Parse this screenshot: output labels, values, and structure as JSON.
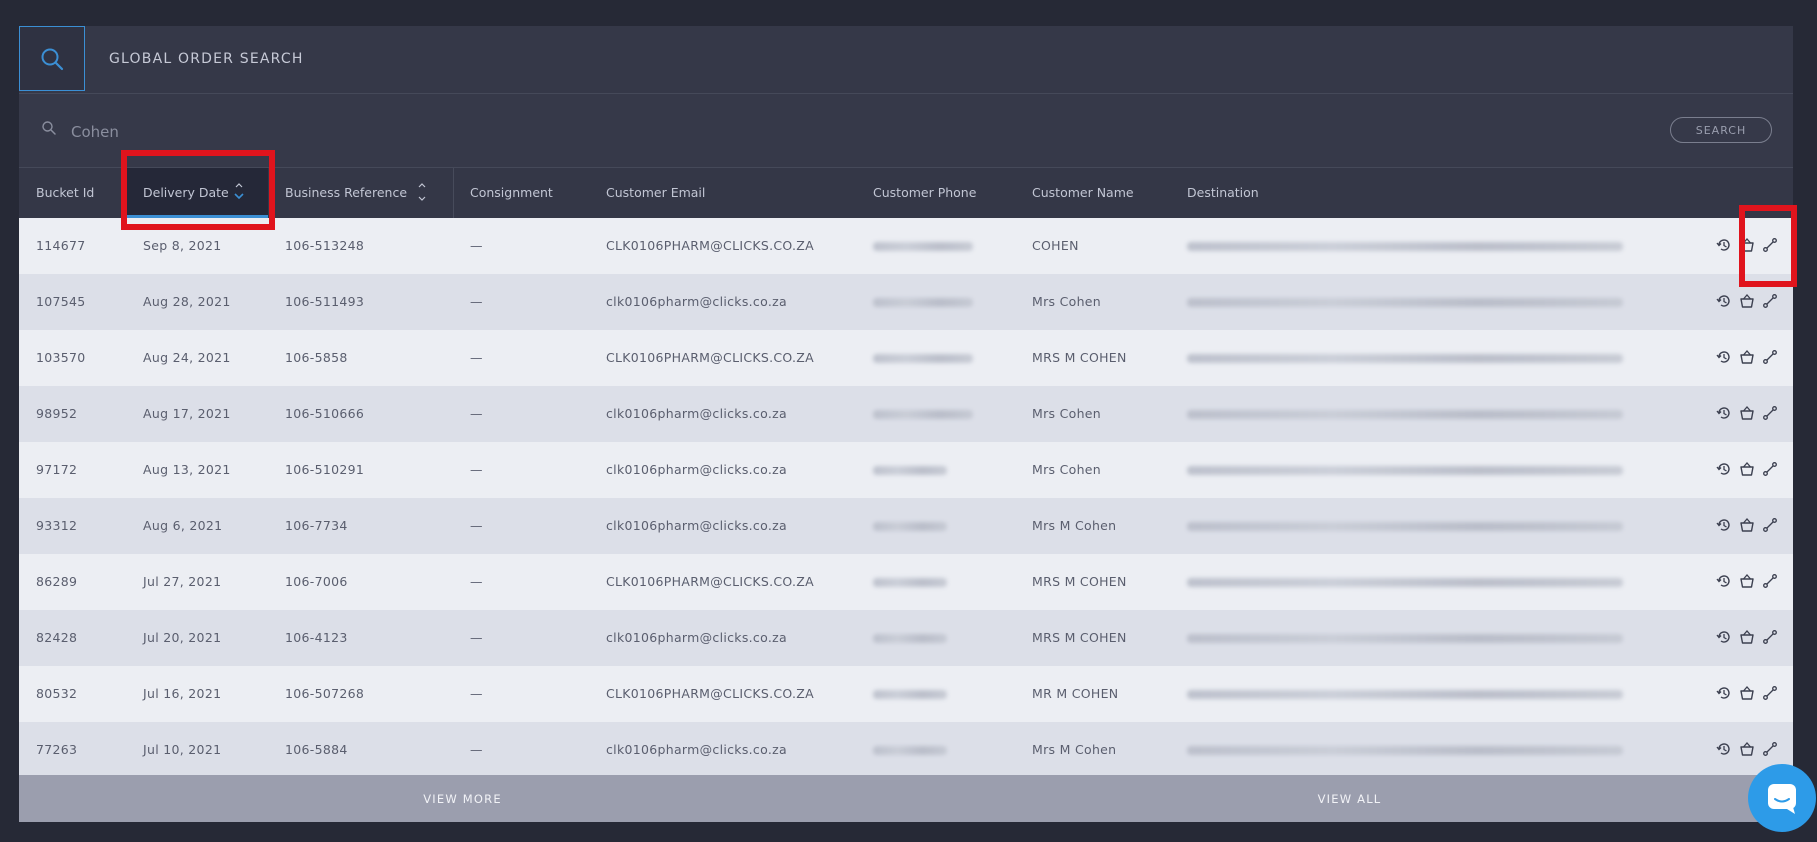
{
  "header": {
    "title": "GLOBAL ORDER SEARCH"
  },
  "search": {
    "value": "Cohen",
    "button_label": "SEARCH"
  },
  "columns": [
    {
      "label": "Bucket Id"
    },
    {
      "label": "Delivery Date",
      "sorted": "descending"
    },
    {
      "label": "Business Reference",
      "sortable": true
    },
    {
      "label": "Consignment"
    },
    {
      "label": "Customer Email"
    },
    {
      "label": "Customer Phone"
    },
    {
      "label": "Customer Name"
    },
    {
      "label": "Destination"
    }
  ],
  "rows": [
    {
      "bucket_id": "114677",
      "delivery_date": "Sep 8, 2021",
      "business_reference": "106-513248",
      "consignment": "—",
      "customer_email": "CLK0106PHARM@CLICKS.CO.ZA",
      "customer_name": "COHEN"
    },
    {
      "bucket_id": "107545",
      "delivery_date": "Aug 28, 2021",
      "business_reference": "106-511493",
      "consignment": "—",
      "customer_email": "clk0106pharm@clicks.co.za",
      "customer_name": "Mrs Cohen"
    },
    {
      "bucket_id": "103570",
      "delivery_date": "Aug 24, 2021",
      "business_reference": "106-5858",
      "consignment": "—",
      "customer_email": "CLK0106PHARM@CLICKS.CO.ZA",
      "customer_name": "MRS M COHEN"
    },
    {
      "bucket_id": "98952",
      "delivery_date": "Aug 17, 2021",
      "business_reference": "106-510666",
      "consignment": "—",
      "customer_email": "clk0106pharm@clicks.co.za",
      "customer_name": "Mrs Cohen"
    },
    {
      "bucket_id": "97172",
      "delivery_date": "Aug 13, 2021",
      "business_reference": "106-510291",
      "consignment": "—",
      "customer_email": "clk0106pharm@clicks.co.za",
      "customer_name": "Mrs Cohen"
    },
    {
      "bucket_id": "93312",
      "delivery_date": "Aug 6, 2021",
      "business_reference": "106-7734",
      "consignment": "—",
      "customer_email": "clk0106pharm@clicks.co.za",
      "customer_name": "Mrs M Cohen"
    },
    {
      "bucket_id": "86289",
      "delivery_date": "Jul 27, 2021",
      "business_reference": "106-7006",
      "consignment": "—",
      "customer_email": "CLK0106PHARM@CLICKS.CO.ZA",
      "customer_name": "MRS M COHEN"
    },
    {
      "bucket_id": "82428",
      "delivery_date": "Jul 20, 2021",
      "business_reference": "106-4123",
      "consignment": "—",
      "customer_email": "clk0106pharm@clicks.co.za",
      "customer_name": "MRS M COHEN"
    },
    {
      "bucket_id": "80532",
      "delivery_date": "Jul 16, 2021",
      "business_reference": "106-507268",
      "consignment": "—",
      "customer_email": "CLK0106PHARM@CLICKS.CO.ZA",
      "customer_name": "MR M COHEN"
    },
    {
      "bucket_id": "77263",
      "delivery_date": "Jul 10, 2021",
      "business_reference": "106-5884",
      "consignment": "—",
      "customer_email": "clk0106pharm@clicks.co.za",
      "customer_name": "Mrs M Cohen"
    }
  ],
  "footer": {
    "view_more": "VIEW MORE",
    "view_all": "VIEW ALL"
  },
  "icons": {
    "header": "search-icon",
    "search_field": "search-icon",
    "row_actions": [
      "history-icon",
      "basket-icon",
      "route-icon"
    ],
    "chat": "chat-icon"
  },
  "colors": {
    "accent": "#3b8fd4",
    "highlight": "#e0141d",
    "chat": "#2d9be8"
  }
}
